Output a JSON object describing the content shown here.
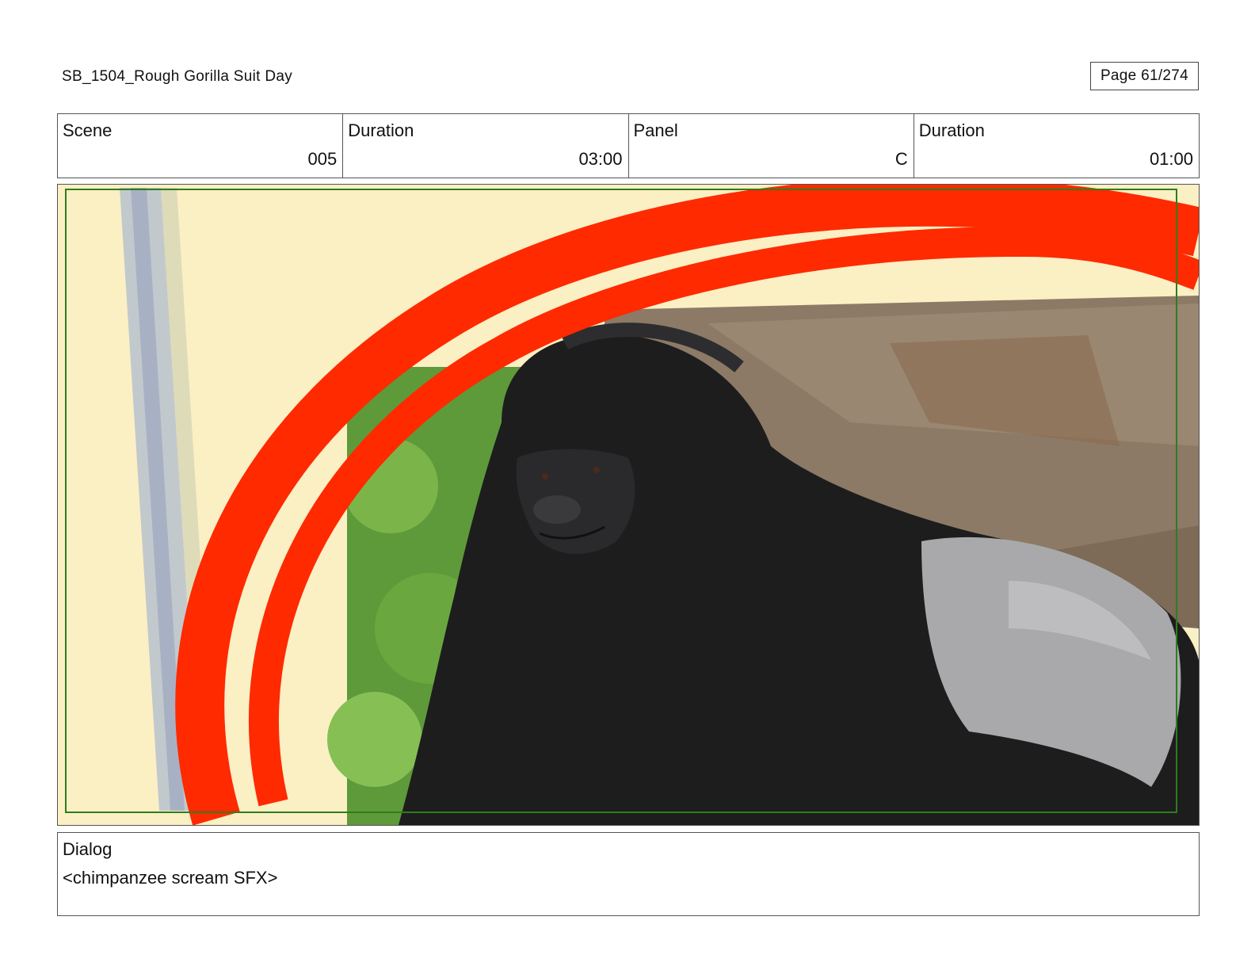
{
  "header": {
    "title": "SB_1504_Rough  Gorilla Suit Day",
    "page": "Page  61/274"
  },
  "info": {
    "scene_label": "Scene",
    "scene_value": "005",
    "scene_duration_label": "Duration",
    "scene_duration_value": "03:00",
    "panel_label": "Panel",
    "panel_value": "C",
    "panel_duration_label": "Duration",
    "panel_duration_value": "01:00"
  },
  "panel": {
    "image_subject": "gorilla-photo",
    "colors": {
      "background": "#fbefc4",
      "stroke": "#ff2a00",
      "frame_guide": "#2e7d1e",
      "rock": "#8c7a66",
      "foliage": "#5e9a3a",
      "fur": "#1d1d1e",
      "silverback": "#a9a9ab"
    }
  },
  "dialog": {
    "label": "Dialog",
    "text": "<chimpanzee scream SFX>"
  }
}
